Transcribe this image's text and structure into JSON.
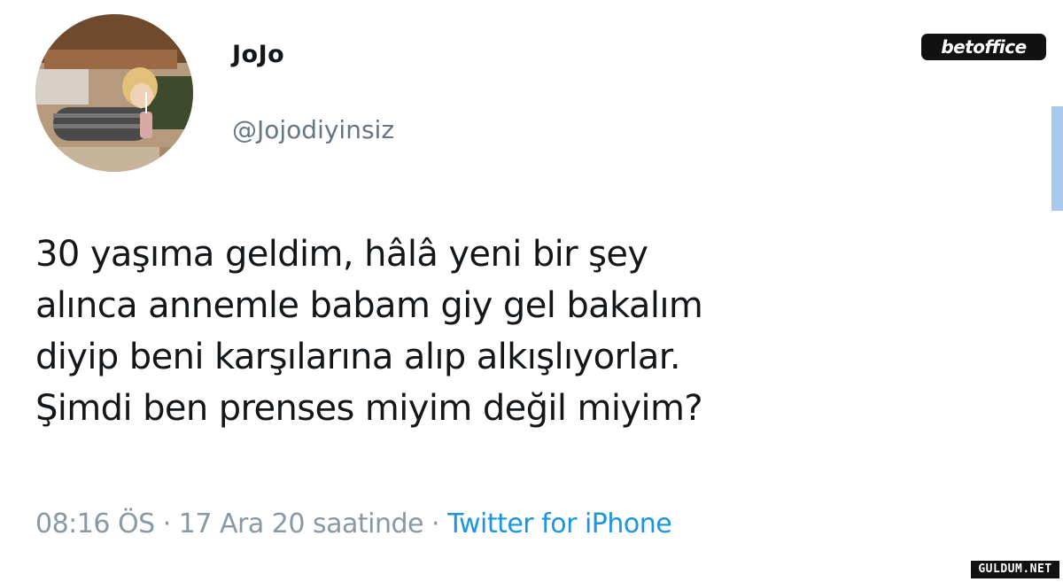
{
  "tweet": {
    "display_name": "JoJo",
    "handle": "@Jojodiyinsiz",
    "text": "30 yaşıma geldim, hâlâ yeni bir şey\nalınca annemle babam giy gel bakalım\ndiyip beni karşılarına alıp alkışlıyorlar.\nŞimdi ben prenses miyim değil miyim?",
    "time": "08:16 ÖS",
    "separator": " · ",
    "date": "17 Ara 20 saatinde",
    "source": "Twitter for iPhone",
    "avatar_icon": "profile-photo",
    "source_color": "#1b95e0"
  },
  "watermarks": {
    "top": "betoffice",
    "bottom": "GULDUM.NET"
  }
}
